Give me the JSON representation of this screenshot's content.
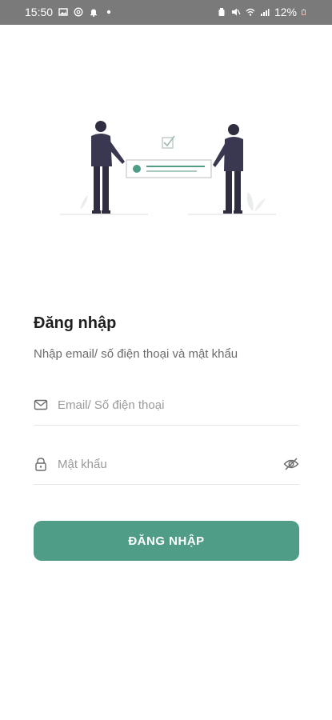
{
  "status_bar": {
    "time": "15:50",
    "battery_percent": "12%",
    "icons_left": [
      "gallery-icon",
      "at-icon",
      "notification-bell-icon",
      "dot-icon"
    ],
    "icons_right": [
      "alarm-icon",
      "mute-icon",
      "wifi-icon",
      "signal-icon",
      "battery-icon"
    ]
  },
  "login": {
    "title": "Đăng nhập",
    "subtitle": "Nhập email/ số điện thoại và mật khẩu",
    "email_placeholder": "Email/ Số điện thoại",
    "password_placeholder": "Mật khẩu",
    "button_label": "ĐĂNG NHẬP"
  },
  "colors": {
    "accent": "#4f9d87",
    "status_bar": "#7a7a7a"
  }
}
